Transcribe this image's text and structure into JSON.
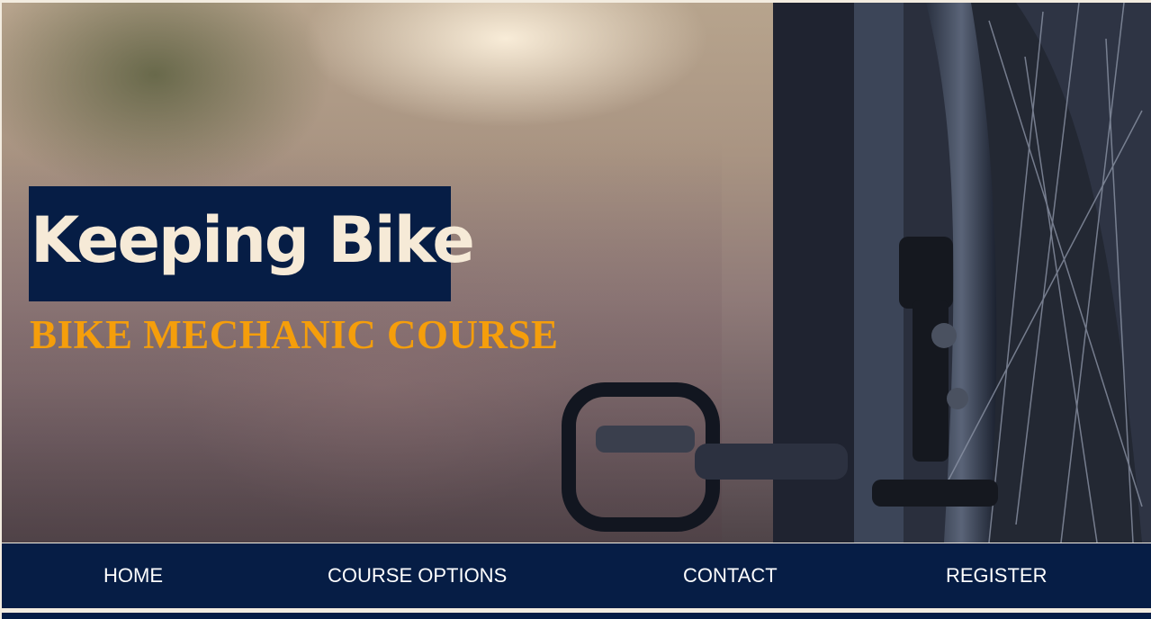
{
  "hero": {
    "title": "Keeping Bike",
    "subtitle": "BIKE MECHANIC COURSE",
    "image_description_icon": "bike-photo"
  },
  "nav": {
    "items": [
      {
        "label": "HOME"
      },
      {
        "label": "COURSE OPTIONS"
      },
      {
        "label": "CONTACT"
      },
      {
        "label": "REGISTER"
      }
    ]
  },
  "colors": {
    "navy": "#061d45",
    "title_text": "#f6ead7",
    "subtitle_orange": "#f59e0b",
    "nav_text": "#ffffff"
  }
}
